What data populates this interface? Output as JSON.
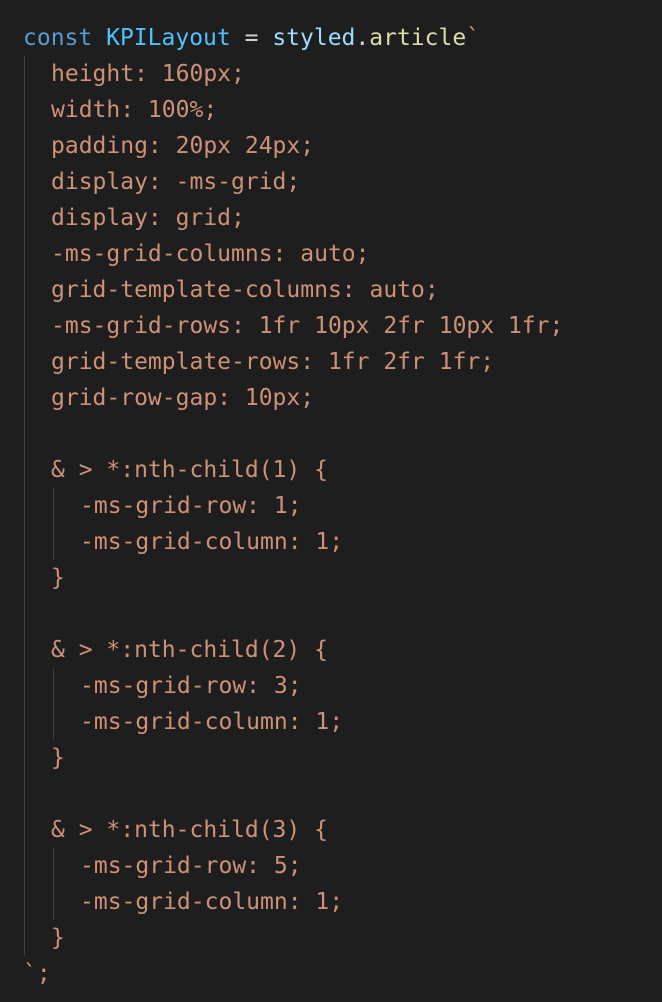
{
  "code": {
    "line1": {
      "keyword": "const",
      "name": "KPILayout",
      "equals": "=",
      "object": "styled",
      "dot": ".",
      "method": "article",
      "backtick": "`"
    },
    "lines": [
      "height: 160px;",
      "width: 100%;",
      "padding: 20px 24px;",
      "display: -ms-grid;",
      "display: grid;",
      "-ms-grid-columns: auto;",
      "grid-template-columns: auto;",
      "-ms-grid-rows: 1fr 10px 2fr 10px 1fr;",
      "grid-template-rows: 1fr 2fr 1fr;",
      "grid-row-gap: 10px;"
    ],
    "blocks": [
      {
        "selector": "& > *:nth-child(1) {",
        "row": "-ms-grid-row: 1;",
        "column": "-ms-grid-column: 1;",
        "close": "}"
      },
      {
        "selector": "& > *:nth-child(2) {",
        "row": "-ms-grid-row: 3;",
        "column": "-ms-grid-column: 1;",
        "close": "}"
      },
      {
        "selector": "& > *:nth-child(3) {",
        "row": "-ms-grid-row: 5;",
        "column": "-ms-grid-column: 1;",
        "close": "}"
      }
    ],
    "end": "`;"
  }
}
